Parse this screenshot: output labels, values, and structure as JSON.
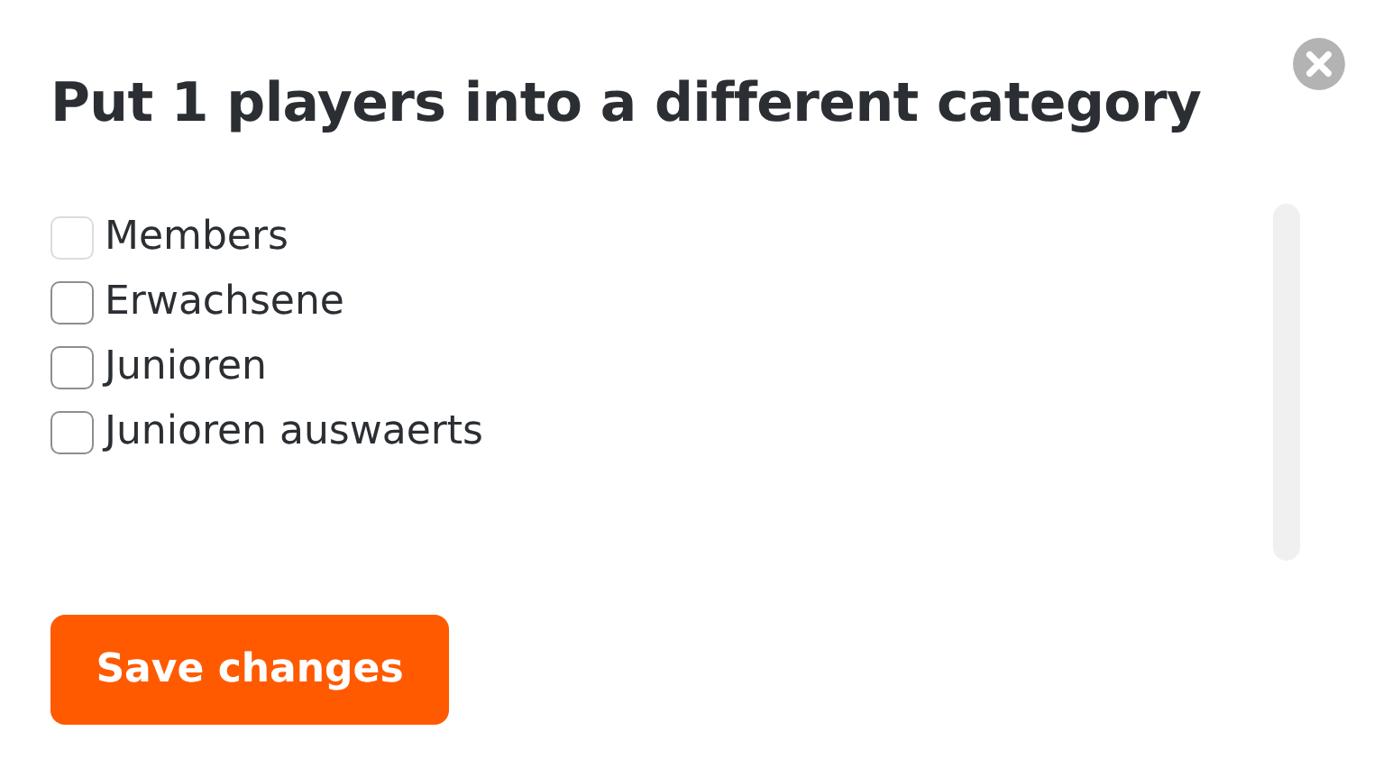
{
  "dialog": {
    "title": "Put 1 players into a different category"
  },
  "categories": [
    {
      "label": "Members",
      "checked": false,
      "disabled": true
    },
    {
      "label": "Erwachsene",
      "checked": false,
      "disabled": false
    },
    {
      "label": "Junioren",
      "checked": false,
      "disabled": false
    },
    {
      "label": "Junioren auswaerts",
      "checked": false,
      "disabled": false
    }
  ],
  "buttons": [
    {
      "label": "Save changes"
    }
  ]
}
